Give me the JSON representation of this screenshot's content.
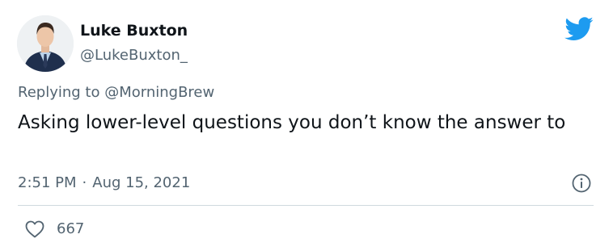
{
  "author": {
    "name": "Luke Buxton",
    "handle": "@LukeBuxton_"
  },
  "reply_context": "Replying to @MorningBrew",
  "tweet_text": "Asking lower-level questions you don’t know the answer to",
  "timestamp": {
    "time": "2:51 PM",
    "separator": "·",
    "date": "Aug 15, 2021"
  },
  "stats": {
    "likes": "667"
  },
  "icons": {
    "brand": "twitter-bird-icon",
    "info": "info-icon",
    "like": "heart-icon"
  },
  "colors": {
    "twitter_blue": "#1d9bf0",
    "secondary_text": "#536471",
    "primary_text": "#0f1419",
    "divider": "#cfd9de"
  }
}
